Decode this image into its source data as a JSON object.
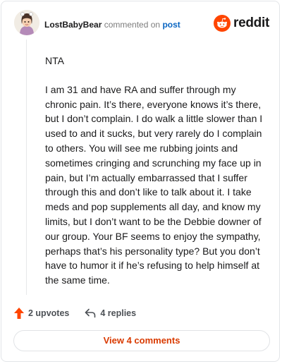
{
  "header": {
    "username": "LostBabyBear",
    "action_text": "commented on",
    "post_link": "post",
    "avatar_icon": "cartoon-avatar-icon",
    "logo_icon": "reddit-snoo-icon",
    "logo_text": "reddit"
  },
  "comment": {
    "paragraphs": [
      "NTA",
      "I am 31 and have RA and suffer through my chronic pain. It’s there, everyone knows it’s there, but I don’t complain. I do walk a little slower than I used to and it sucks, but very rarely do I complain to others. You will see me rubbing joints and sometimes cringing and scrunching my face up in pain, but I’m actually embarrassed that I suffer through this and don’t like to talk about it. I take meds and pop supplements all day, and know my limits, but I don’t want to be the Debbie downer of our group. Your BF seems to enjoy the sympathy, perhaps that’s his personality type? But you don’t have to humor it if he’s refusing to help himself at the same time."
    ]
  },
  "footer": {
    "upvotes_label": "2 upvotes",
    "upvote_icon": "upvote-arrow-icon",
    "replies_label": "4 replies",
    "reply_icon": "reply-arrow-icon",
    "view_comments_label": "View 4 comments"
  },
  "colors": {
    "brand": "#ff4500",
    "link": "#0a66c2",
    "view_button_text": "#d93a00"
  }
}
